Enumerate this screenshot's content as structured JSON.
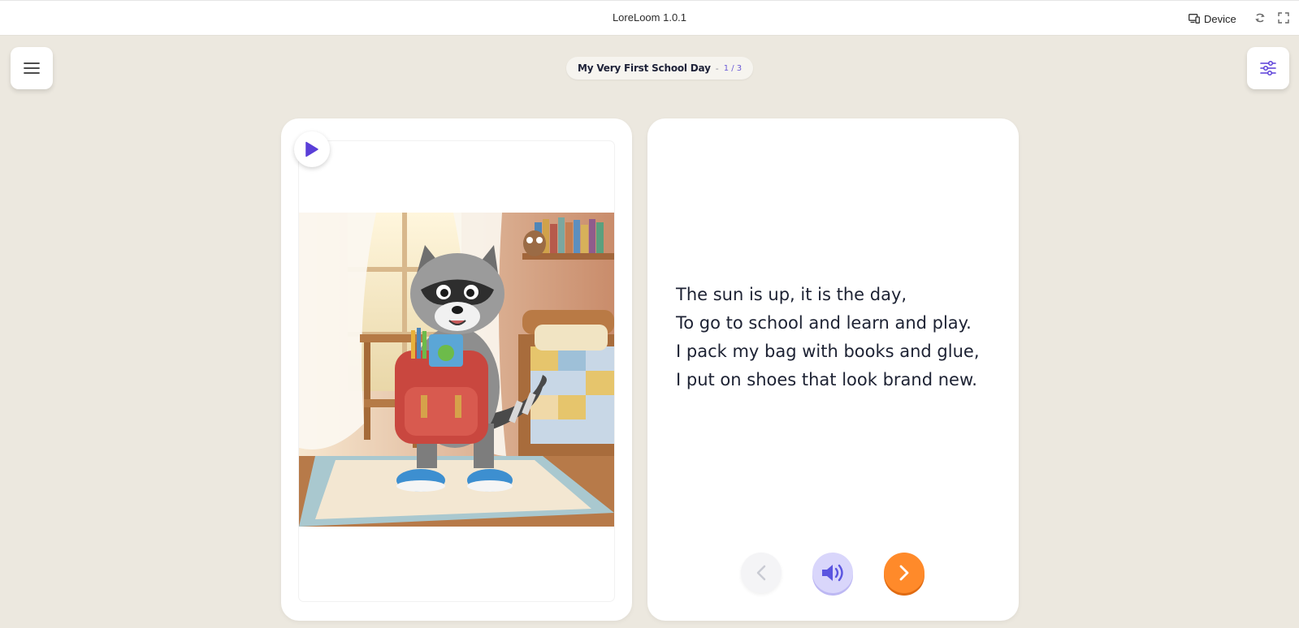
{
  "app": {
    "title": "LoreLoom 1.0.1",
    "device_label": "Device"
  },
  "story": {
    "title": "My Very First School Day",
    "separator": "-",
    "page_indicator": "1 / 3",
    "lines": [
      "The sun is up, it is the day,",
      "To go to school and learn and play.",
      "I pack my bag with books and glue,",
      "I put on shoes that look brand new."
    ]
  },
  "icons": {
    "menu": "hamburger-menu-icon",
    "settings": "sliders-icon",
    "device": "monitor-phone-icon",
    "rotate": "rotate-icon",
    "fullscreen": "fullscreen-icon",
    "play": "play-icon",
    "prev": "chevron-left-icon",
    "audio": "speaker-icon",
    "next": "chevron-right-icon"
  },
  "colors": {
    "background": "#ece8df",
    "accent_purple": "#5a3fd8",
    "next_orange": "#ff8a2a",
    "audio_bg": "#d9d6fb"
  }
}
